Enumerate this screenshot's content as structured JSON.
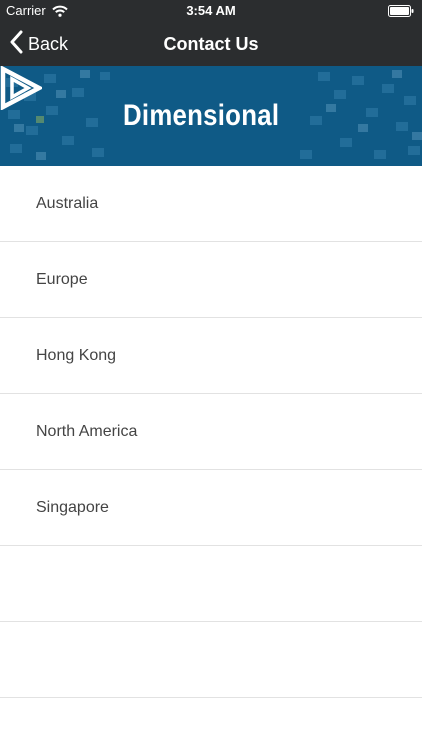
{
  "status_bar": {
    "carrier": "Carrier",
    "time": "3:54 AM"
  },
  "nav": {
    "back_label": "Back",
    "title": "Contact Us"
  },
  "banner": {
    "brand": "Dimensional"
  },
  "regions": [
    {
      "label": "Australia"
    },
    {
      "label": "Europe"
    },
    {
      "label": "Hong Kong"
    },
    {
      "label": "North America"
    },
    {
      "label": "Singapore"
    },
    {
      "label": ""
    },
    {
      "label": ""
    }
  ],
  "colors": {
    "bar_background": "#2b2d2f",
    "banner_background": "#0f5a86",
    "list_text": "#444444",
    "separator": "#e2e2e2"
  },
  "icons": [
    "wifi-icon",
    "battery-icon",
    "chevron-left-icon",
    "dimensional-logo-icon"
  ]
}
